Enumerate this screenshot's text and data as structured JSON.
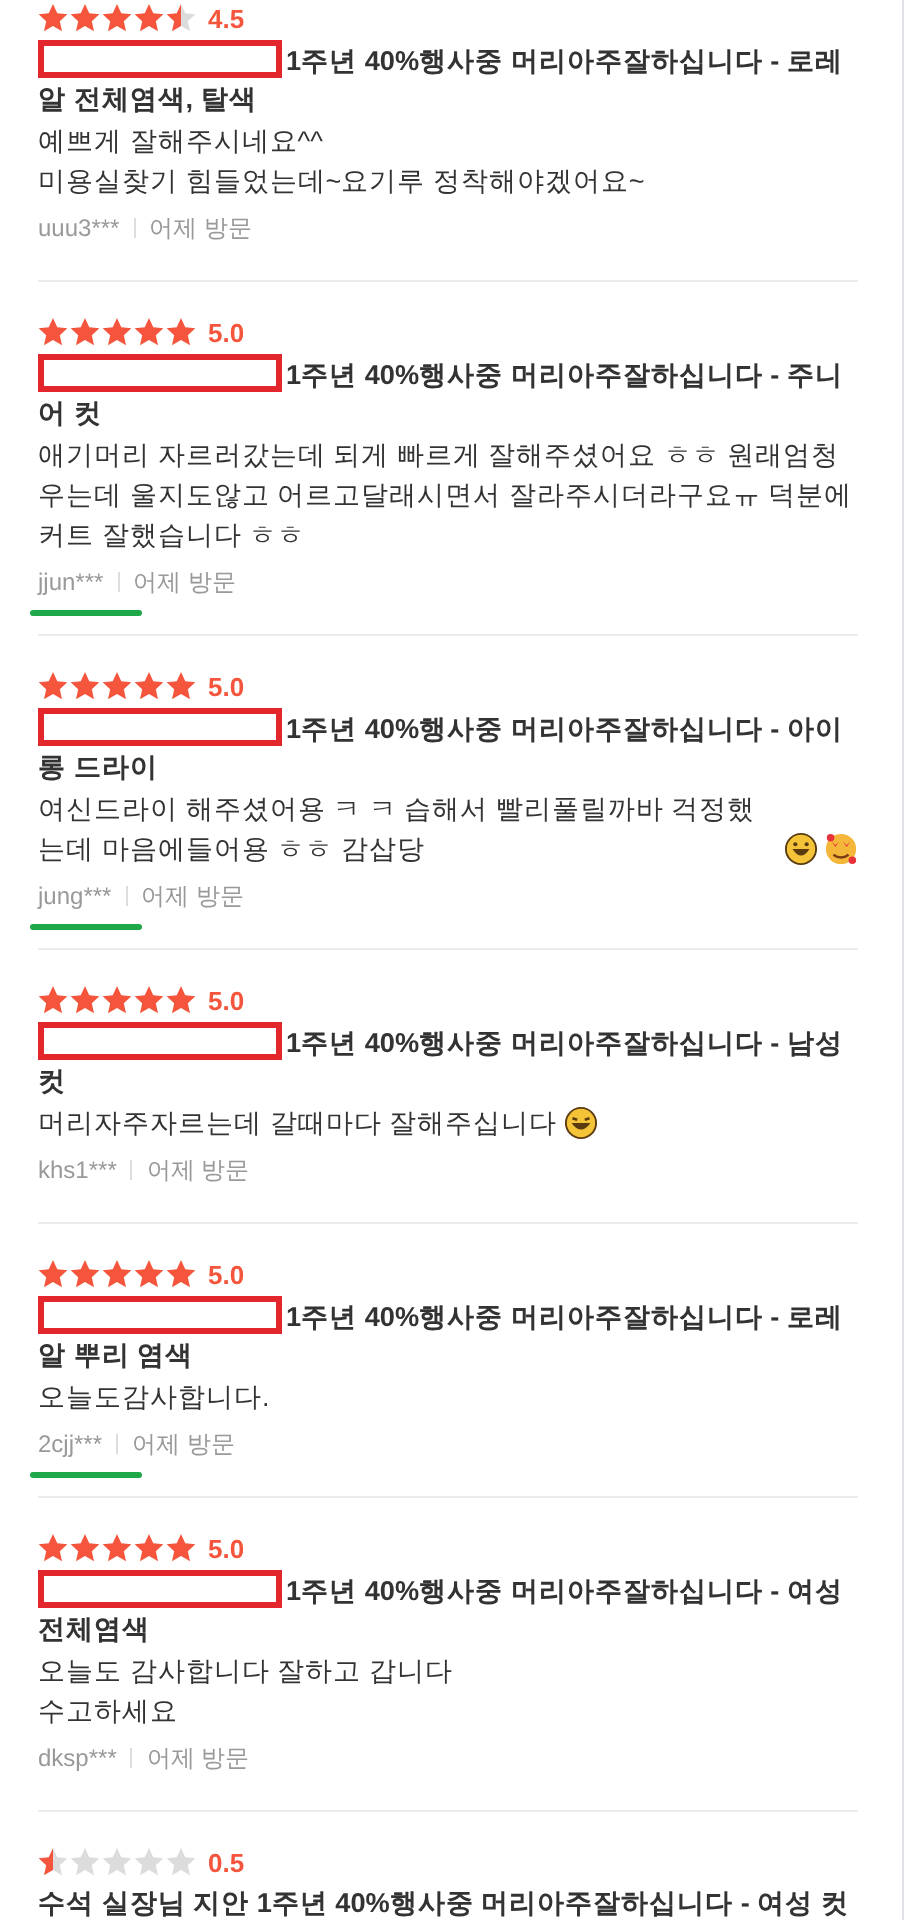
{
  "reviews": [
    {
      "stars": 4.5,
      "rating": "4.5",
      "redacted": true,
      "title": "1주년 40%행사중 머리아주잘하십니다 - 로레알 전체염색, 탈색",
      "body": [
        "예쁘게 잘해주시네요^^",
        "미용실찾기 힘들었는데~요기루 정착해야겠어요~"
      ],
      "user": "uuu3***",
      "underlined": false,
      "visit": "어제 방문"
    },
    {
      "stars": 5,
      "rating": "5.0",
      "redacted": true,
      "title": "1주년 40%행사중 머리아주잘하십니다 - 주니어 컷",
      "body": [
        "애기머리 자르러갔는데 되게 빠르게 잘해주셨어요 ㅎㅎ 원래엄청 우는데 울지도않고 어르고달래시면서 잘라주시더라구요ㅠ 덕분에 커트 잘했습니다 ㅎㅎ"
      ],
      "user": "jjun***",
      "underlined": true,
      "visit": "어제 방문"
    },
    {
      "stars": 5,
      "rating": "5.0",
      "redacted": true,
      "title": "1주년 40%행사중 머리아주잘하십니다 - 아이롱 드라이",
      "body": [
        "여신드라이 해주셨어용 ㅋ ㅋ 습해서 빨리풀릴까바 걱정했는데 마음에들어용 ㅎㅎ 감삽당"
      ],
      "icons": [
        {
          "kind": "grin"
        },
        {
          "kind": "smitten"
        }
      ],
      "user": "jung***",
      "underlined": true,
      "visit": "어제 방문"
    },
    {
      "stars": 5,
      "rating": "5.0",
      "redacted": true,
      "title": "1주년 40%행사중 머리아주잘하십니다 - 남성 컷",
      "body": [
        "머리자주자르는데 갈때마다 잘해주십니다"
      ],
      "icons": [
        {
          "kind": "laugh"
        }
      ],
      "user": "khs1***",
      "underlined": false,
      "visit": "어제 방문"
    },
    {
      "stars": 5,
      "rating": "5.0",
      "redacted": true,
      "title": "1주년 40%행사중 머리아주잘하십니다 - 로레알 뿌리 염색",
      "body": [
        "오늘도감사합니다."
      ],
      "user": "2cjj***",
      "underlined": true,
      "visit": "어제 방문"
    },
    {
      "stars": 5,
      "rating": "5.0",
      "redacted": true,
      "title": "1주년 40%행사중 머리아주잘하십니다 - 여성 전체염색",
      "body": [
        "오늘도 감사합니다 잘하고 갑니다",
        "수고하세요"
      ],
      "user": "dksp***",
      "underlined": false,
      "visit": "어제 방문"
    },
    {
      "stars": 0.5,
      "rating": "0.5",
      "redacted": false,
      "title": "수석 실장님 지안 1주년 40%행사중 머리아주잘하십니다 - 여성 컷"
    }
  ]
}
